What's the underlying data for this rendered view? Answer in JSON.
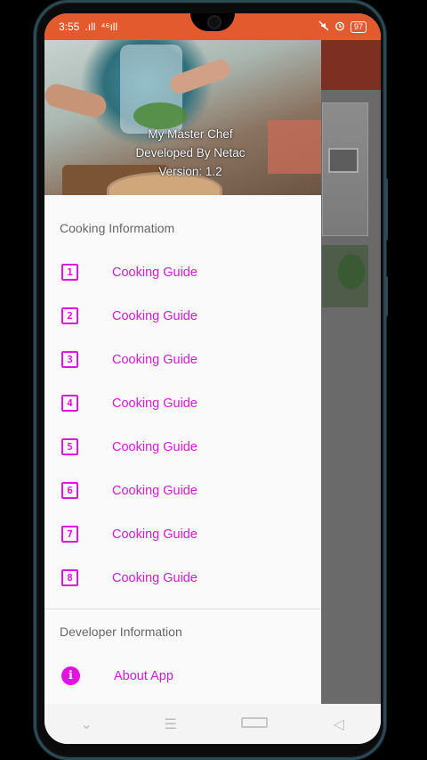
{
  "status_bar": {
    "time": "3:55",
    "signal_left": ".ıll",
    "signal_right": "⁴⁶ıll",
    "battery": "97",
    "icons": [
      "mute-icon",
      "alarm-icon",
      "battery-icon"
    ]
  },
  "drawer": {
    "header": {
      "line1": "My Master Chef",
      "line2": "Developed By Netac",
      "line3": "Version: 1.2"
    },
    "section1_title": "Cooking Informatiom",
    "items": [
      {
        "num": "1",
        "label": "Cooking Guide"
      },
      {
        "num": "2",
        "label": "Cooking Guide"
      },
      {
        "num": "3",
        "label": "Cooking Guide"
      },
      {
        "num": "4",
        "label": "Cooking Guide"
      },
      {
        "num": "5",
        "label": "Cooking Guide"
      },
      {
        "num": "6",
        "label": "Cooking Guide"
      },
      {
        "num": "7",
        "label": "Cooking Guide"
      },
      {
        "num": "8",
        "label": "Cooking Guide"
      }
    ],
    "section2_title": "Developer Information",
    "about": {
      "icon": "i",
      "label": "About App"
    }
  },
  "nav_bar": {
    "back": "◁",
    "home_icon": "square-icon",
    "recents": "☰",
    "down": "⌄"
  },
  "colors": {
    "status_bar": "#e35a2e",
    "accent": "#e014e0",
    "menu_text": "#d41ad4",
    "toolbar_dim": "#7d2f21"
  }
}
